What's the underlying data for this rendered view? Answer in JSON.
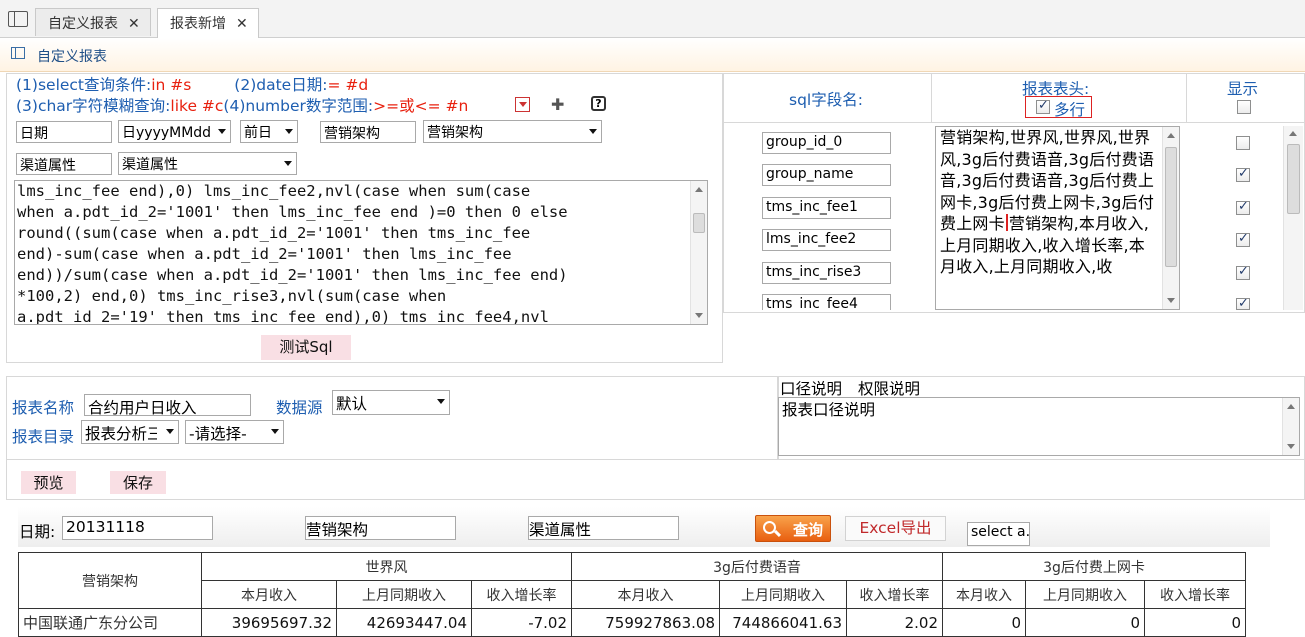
{
  "tabs": [
    {
      "label": "自定义报表",
      "active": false
    },
    {
      "label": "报表新增",
      "active": true
    }
  ],
  "breadcrumb": "自定义报表",
  "hints": {
    "line1a_label": "(1)select查询条件:",
    "line1a_val": "in #s",
    "line1b_label": "(2)date日期:",
    "line1b_val": "= #d",
    "line2a_label": "(3)char字符模糊查询:",
    "line2a_val": "like #c",
    "line2b_label": "(4)number数字范围:",
    "line2b_val": ">=或<= #n"
  },
  "params": {
    "date_label": "日期",
    "date_format": "日yyyyMMdd",
    "date_offset": "前日",
    "org_label": "营销架构",
    "org_select": "营销架构",
    "channel_label": "渠道属性",
    "channel_select": "渠道属性"
  },
  "sql_text": "lms_inc_fee end),0) lms_inc_fee2,nvl(case when sum(case\nwhen a.pdt_id_2='1001' then lms_inc_fee end )=0 then 0 else\nround((sum(case when a.pdt_id_2='1001' then tms_inc_fee\nend)-sum(case when a.pdt_id_2='1001' then lms_inc_fee\nend))/sum(case when a.pdt_id_2='1001' then lms_inc_fee end)\n*100,2) end,0) tms_inc_rise3,nvl(sum(case when\na.pdt_id_2='19' then tms_inc_fee end),0) tms_inc_fee4,nvl",
  "test_sql_button": "测试Sql",
  "fields_header": {
    "sql_field_name": "sql字段名:",
    "report_header": "报表表头:",
    "multiline": "多行",
    "display": "显示"
  },
  "fields": [
    {
      "name": "group_id_0",
      "show": false
    },
    {
      "name": "group_name",
      "show": true
    },
    {
      "name": "tms_inc_fee1",
      "show": true
    },
    {
      "name": "lms_inc_fee2",
      "show": true
    },
    {
      "name": "tms_inc_rise3",
      "show": true
    },
    {
      "name": "tms_inc_fee4",
      "show": true
    }
  ],
  "header_text_before_caret": "营销架构,世界风,世界风,世界风,3g后付费语音,3g后付费语音,3g后付费语音,3g后付费上网卡,3g后付费上网卡,3g后付费上网卡",
  "header_text_after_caret": "营销架构,本月收入,上月同期收入,收入增长率,本月收入,上月同期收入,收",
  "report": {
    "name_label": "报表名称",
    "name_value": "合约用户日收入",
    "datasource_label": "数据源",
    "datasource_value": "默认",
    "catalog_label": "报表目录",
    "catalog_value": "报表分析三",
    "catalog_sub": "-请选择-",
    "caliber_tab": "口径说明",
    "permission_tab": "权限说明",
    "caliber_text": "报表口径说明"
  },
  "preview_button": "预览",
  "save_button": "保存",
  "query_bar": {
    "date_label": "日期:",
    "date_value": "20131118",
    "org_value": "营销架构",
    "channel_value": "渠道属性",
    "query_button": "查询",
    "excel_button": "Excel导出",
    "sql_box": "select a.c"
  },
  "result_table": {
    "row_header": "营销架构",
    "groups": [
      "世界风",
      "3g后付费语音",
      "3g后付费上网卡"
    ],
    "sub_headers": [
      "本月收入",
      "上月同期收入",
      "收入增长率"
    ],
    "rows": [
      {
        "name": "中国联通广东分公司",
        "values": [
          "39695697.32",
          "42693447.04",
          "-7.02",
          "759927863.08",
          "744866041.63",
          "2.02",
          "0",
          "0",
          "0"
        ]
      }
    ]
  },
  "colors": {
    "accent_blue": "#1e5eb0",
    "accent_red": "#e8210f",
    "pink_button": "#f9dfe4",
    "query_orange": "#f07a22"
  }
}
